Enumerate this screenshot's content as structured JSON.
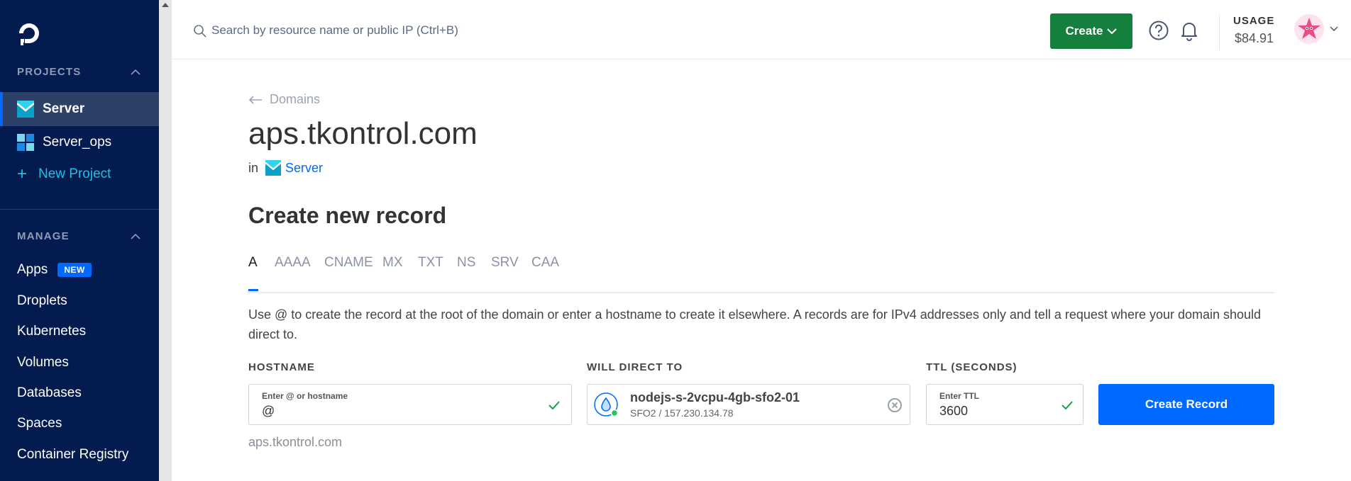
{
  "sidebar": {
    "projects_heading": "PROJECTS",
    "projects": [
      {
        "label": "Server",
        "active": true
      },
      {
        "label": "Server_ops",
        "active": false
      }
    ],
    "new_project_label": "New Project",
    "manage_heading": "MANAGE",
    "nav": [
      {
        "label": "Apps",
        "badge": "NEW"
      },
      {
        "label": "Droplets"
      },
      {
        "label": "Kubernetes"
      },
      {
        "label": "Volumes"
      },
      {
        "label": "Databases"
      },
      {
        "label": "Spaces"
      },
      {
        "label": "Container Registry"
      }
    ]
  },
  "topbar": {
    "search_placeholder": "Search by resource name or public IP (Ctrl+B)",
    "create_label": "Create",
    "usage_label": "USAGE",
    "usage_value": "$84.91"
  },
  "main": {
    "back_label": "Domains",
    "domain_title": "aps.tkontrol.com",
    "in_label": "in",
    "project_link": "Server",
    "section_title": "Create new record",
    "tabs": [
      "A",
      "AAAA",
      "CNAME",
      "MX",
      "TXT",
      "NS",
      "SRV",
      "CAA"
    ],
    "active_tab": "A",
    "description": "Use @ to create the record at the root of the domain or enter a hostname to create it elsewhere. A records are for IPv4 addresses only and tell a request where your domain should direct to.",
    "hostname": {
      "label": "HOSTNAME",
      "mini": "Enter @ or hostname",
      "value": "@",
      "hint": "aps.tkontrol.com"
    },
    "direct_to": {
      "label": "WILL DIRECT TO",
      "droplet_name": "nodejs-s-2vcpu-4gb-sfo2-01",
      "droplet_sub": "SFO2 / 157.230.134.78"
    },
    "ttl": {
      "label": "TTL (SECONDS)",
      "mini": "Enter TTL",
      "value": "3600"
    },
    "submit_label": "Create Record"
  },
  "colors": {
    "sidebar_bg": "#031b4e",
    "accent": "#0069ff",
    "create_green": "#15803d"
  }
}
